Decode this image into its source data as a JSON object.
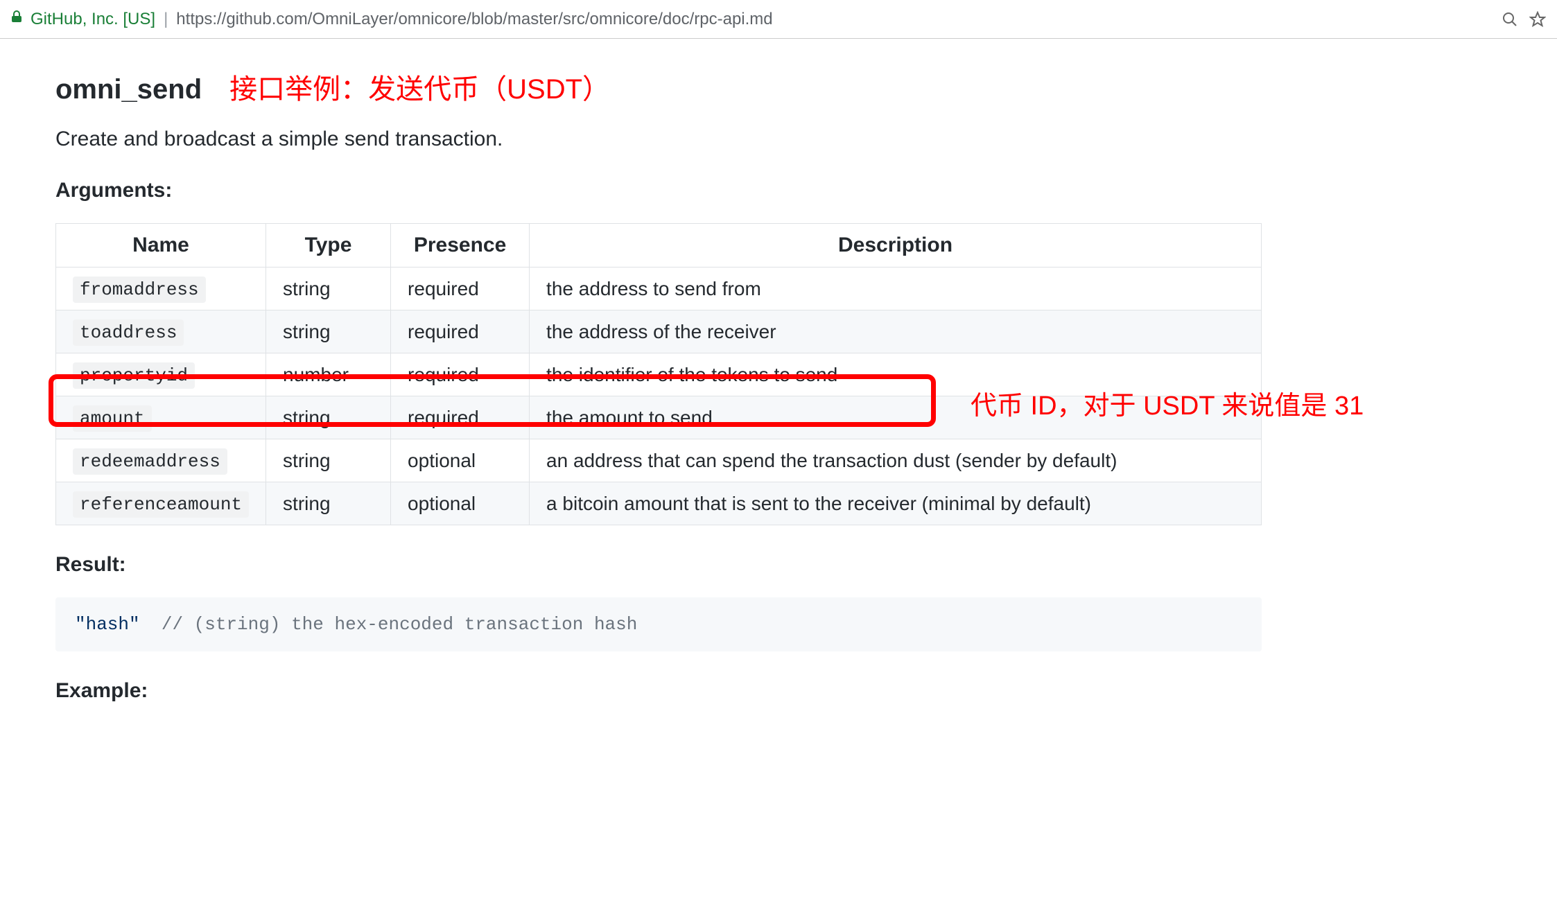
{
  "browser": {
    "site_label": "GitHub, Inc. [US]",
    "url": "https://github.com/OmniLayer/omnicore/blob/master/src/omnicore/doc/rpc-api.md"
  },
  "api": {
    "name": "omni_send",
    "annotation_title": "接口举例：发送代币（USDT）",
    "description": "Create and broadcast a simple send transaction.",
    "arguments_heading": "Arguments:",
    "table_headers": {
      "name": "Name",
      "type": "Type",
      "presence": "Presence",
      "description": "Description"
    },
    "args": [
      {
        "name": "fromaddress",
        "type": "string",
        "presence": "required",
        "description": "the address to send from"
      },
      {
        "name": "toaddress",
        "type": "string",
        "presence": "required",
        "description": "the address of the receiver"
      },
      {
        "name": "propertyid",
        "type": "number",
        "presence": "required",
        "description": "the identifier of the tokens to send"
      },
      {
        "name": "amount",
        "type": "string",
        "presence": "required",
        "description": "the amount to send"
      },
      {
        "name": "redeemaddress",
        "type": "string",
        "presence": "optional",
        "description": "an address that can spend the transaction dust (sender by default)"
      },
      {
        "name": "referenceamount",
        "type": "string",
        "presence": "optional",
        "description": "a bitcoin amount that is sent to the receiver (minimal by default)"
      }
    ],
    "row_annotation": "代币 ID，对于 USDT 来说值是 31",
    "result_heading": "Result:",
    "result_code_hash": "\"hash\"",
    "result_code_comment": "// (string) the hex-encoded transaction hash",
    "example_heading": "Example:"
  }
}
